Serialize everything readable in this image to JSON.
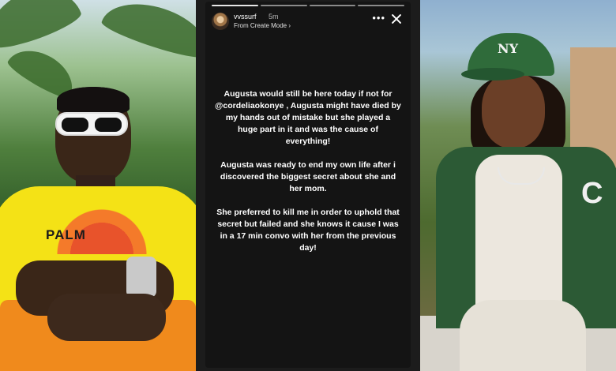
{
  "left_photo": {
    "shirt_text": "PALM"
  },
  "story": {
    "username": "vvssurf",
    "time": "5m",
    "subtext": "From Create Mode ›",
    "more_icon": "more-horizontal-icon",
    "close_icon": "close-icon",
    "progress_segments": 4,
    "progress_done": 1,
    "paragraphs": [
      "Augusta would still be here today if not for @cordeliaokonye , Augusta might have died by my hands out of mistake but she played a huge part in it and was the cause of everything!",
      "Augusta was ready to end my own life after i discovered the biggest secret about she and her mom.",
      "She preferred to kill me in order to uphold that secret but failed and she knows it cause I was in a 17 min convo with her from the previous day!"
    ]
  },
  "right_photo": {
    "cap_logo": "NY",
    "jacket_letter": "C"
  },
  "colors": {
    "story_bg": "#141414",
    "frame_bg": "#1c1c1c",
    "text": "#ffffff"
  }
}
